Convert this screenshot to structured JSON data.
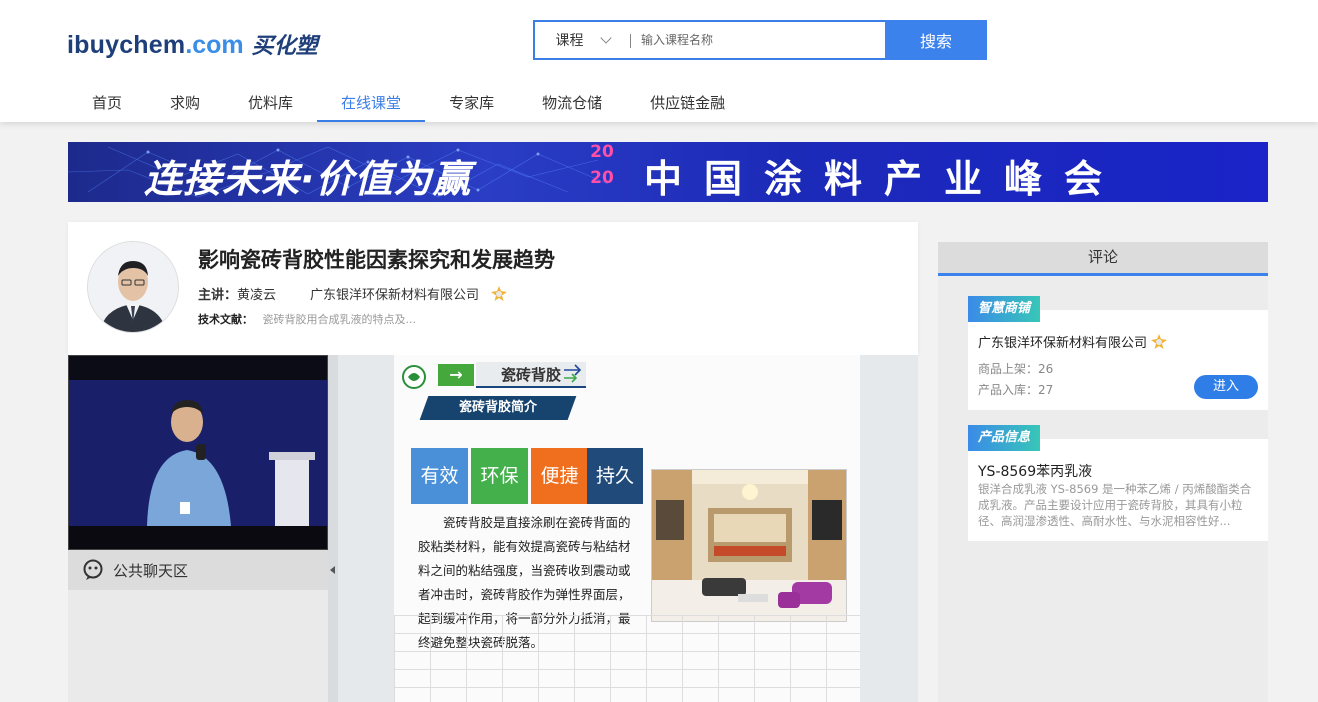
{
  "header": {
    "logo_main": "ibuychem",
    "logo_domain": ".com",
    "logo_cn": "买化塑",
    "search": {
      "category": "课程",
      "placeholder": "输入课程名称",
      "button_label": "搜索"
    },
    "nav": [
      {
        "label": "首页",
        "active": false
      },
      {
        "label": "求购",
        "active": false
      },
      {
        "label": "优料库",
        "active": false
      },
      {
        "label": "在线课堂",
        "active": true
      },
      {
        "label": "专家库",
        "active": false
      },
      {
        "label": "物流仓储",
        "active": false
      },
      {
        "label": "供应链金融",
        "active": false
      }
    ]
  },
  "banner": {
    "left_text": "连接未来·价值为赢",
    "year": "2020",
    "right_text": "中国涂料产业峰会"
  },
  "course": {
    "title": "影响瓷砖背胶性能因素探究和发展趋势",
    "lecturer_label": "主讲：",
    "lecturer_name": "黄凌云",
    "company": "广东银洋环保新材料有限公司",
    "doc_label": "技术文献：",
    "doc_text": "瓷砖背胶用合成乳液的特点及..."
  },
  "chat": {
    "tab_label": "公共聊天区"
  },
  "slide": {
    "heading": "瓷砖背胶",
    "subheading": "瓷砖背胶简介",
    "tiles": [
      "有效",
      "环保",
      "便捷",
      "持久"
    ],
    "body": "瓷砖背胶是直接涂刷在瓷砖背面的胶粘类材料，能有效提高瓷砖与粘结材料之间的粘结强度，当瓷砖收到震动或者冲击时，瓷砖背胶作为弹性界面层，起到缓冲作用，将一部分外力抵消，最终避免整块瓷砖脱落。"
  },
  "sidebar": {
    "comment_tab": "评论",
    "store": {
      "tag": "智慧商铺",
      "name": "广东银洋环保新材料有限公司",
      "listed": "商品上架：26",
      "stocked": "产品入库：27",
      "enter_label": "进入"
    },
    "product": {
      "tag": "产品信息",
      "name": "YS-8569苯丙乳液",
      "desc": "银洋合成乳液 YS-8569 是一种苯乙烯 / 丙烯酸酯类合成乳液。产品主要设计应用于瓷砖背胶，其具有小粒径、高润湿渗透性、高耐水性、与水泥相容性好..."
    }
  },
  "colors": {
    "accent": "#3b7ee8",
    "banner_bg": "#1f2fb0",
    "tag_gradient_start": "#3a8be8",
    "tag_gradient_end": "#38c6b8"
  }
}
